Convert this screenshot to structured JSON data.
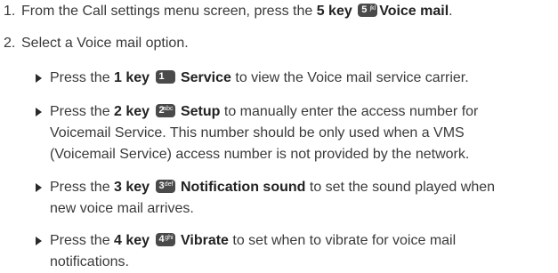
{
  "step1": {
    "number": "1.",
    "pre": "From the Call settings menu screen, press the ",
    "key": "5 key",
    "icon": {
      "digit": "5",
      "sub": "jkl"
    },
    "option": "Voice mail",
    "post": "."
  },
  "step2": {
    "number": "2.",
    "text": "Select a Voice mail option."
  },
  "options": [
    {
      "pre": "Press the ",
      "key": "1 key",
      "icon": {
        "digit": "1",
        "sub": ""
      },
      "option": "Service",
      "line1": " to view the Voice mail service carrier.",
      "line2": "",
      "line3": ""
    },
    {
      "pre": "Press the ",
      "key": "2 key",
      "icon": {
        "digit": "2",
        "sub": "abc"
      },
      "option": "Setup",
      "line1": " to manually enter the access number for",
      "line2": "Voicemail Service. This number should be only used when a VMS",
      "line3": "(Voicemail Service) access number is not provided by the network."
    },
    {
      "pre": "Press the ",
      "key": "3 key",
      "icon": {
        "digit": "3",
        "sub": "def"
      },
      "option": "Notification sound",
      "line1": " to set the sound played when",
      "line2": "new voice mail arrives.",
      "line3": ""
    },
    {
      "pre": "Press the ",
      "key": "4 key",
      "icon": {
        "digit": "4",
        "sub": "ghi"
      },
      "option": "Vibrate",
      "line1": " to set when to vibrate for voice mail",
      "line2": "notifications.",
      "line3": ""
    }
  ]
}
